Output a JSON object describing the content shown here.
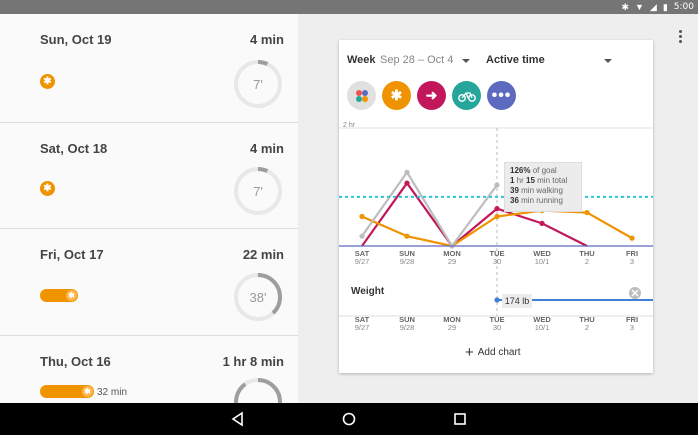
{
  "status_bar": {
    "time": "5:00",
    "icons": [
      "bluetooth-icon",
      "wifi-icon",
      "signal-icon",
      "battery-icon"
    ]
  },
  "days": [
    {
      "date": "Sun, Oct 19",
      "duration": "4 min",
      "ring_label": "7'",
      "progress": 0.07,
      "activity": "dot"
    },
    {
      "date": "Sat, Oct 18",
      "duration": "4 min",
      "ring_label": "7'",
      "progress": 0.07,
      "activity": "dot"
    },
    {
      "date": "Fri, Oct 17",
      "duration": "22 min",
      "ring_label": "38'",
      "progress": 0.38,
      "activity": "bar"
    },
    {
      "date": "Thu, Oct 16",
      "duration": "1 hr 8 min",
      "ring_label": "",
      "progress": 0.9,
      "activity": "bar",
      "bar_caption": "32 min"
    }
  ],
  "card": {
    "week_label": "Week",
    "week_range": "Sep 28 – Oct 4",
    "metric": "Active time",
    "filters": [
      {
        "name": "all-activities",
        "icon": "multi-dot-icon",
        "color": "#e0e0e0"
      },
      {
        "name": "walking",
        "icon": "walking-icon",
        "color": "#f09300"
      },
      {
        "name": "running",
        "icon": "running-icon",
        "color": "#c2185b"
      },
      {
        "name": "cycling",
        "icon": "cycling-icon",
        "color": "#26a69a"
      },
      {
        "name": "more",
        "icon": "more-icon",
        "color": "#5c6bc0"
      }
    ],
    "y_max_label": "2 hr",
    "tooltip": {
      "l1_bold": "126%",
      "l1": " of goal",
      "l2_b1": "1",
      "l2_t1": " hr ",
      "l2_b2": "15",
      "l2_t2": " min total",
      "l3_bold": "39",
      "l3": " min walking",
      "l4_bold": "36",
      "l4": " min running"
    },
    "weight_title": "Weight",
    "weight_value": "174",
    "weight_unit": "lb",
    "add_chart": "Add chart"
  },
  "chart_data": {
    "type": "line",
    "categories": [
      "SAT",
      "SUN",
      "MON",
      "TUE",
      "WED",
      "THU",
      "FRI"
    ],
    "dates": [
      "9/27",
      "9/28",
      "29",
      "30",
      "10/1",
      "2",
      "3"
    ],
    "series": [
      {
        "color": "#c2185b",
        "values": [
          0,
          64,
          0,
          38,
          23,
          0,
          null
        ]
      },
      {
        "color": "#f09300",
        "values": [
          30,
          10,
          0,
          30,
          36,
          34,
          8
        ]
      },
      {
        "color": "#bdbdbd",
        "values": [
          10,
          75,
          0,
          62,
          null,
          null,
          null
        ]
      }
    ],
    "goal_line": 50,
    "ylim": [
      0,
      120
    ],
    "y_tick_label": "2 hr"
  }
}
